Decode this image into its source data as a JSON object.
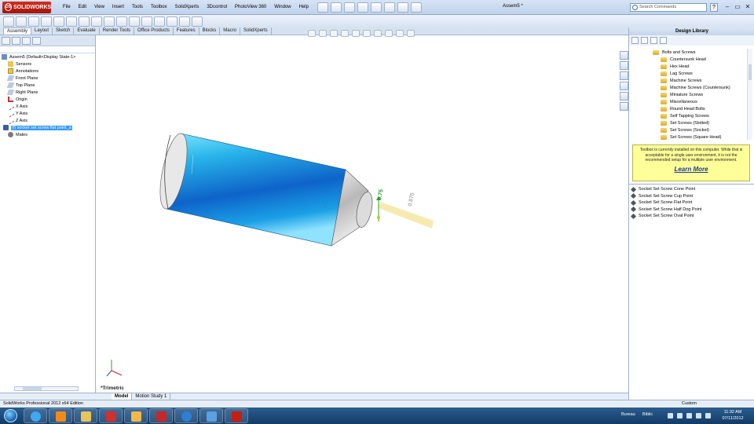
{
  "app": {
    "logo_text": "SOLIDWORKS",
    "logo_mark": "DS",
    "document_title": "Assem5 *",
    "brand_red": "#c41f14",
    "accent_blue": "#3399ff"
  },
  "menu": [
    "File",
    "Edit",
    "View",
    "Insert",
    "Tools",
    "Toolbox",
    "SolidXperts",
    "3Dcontrol",
    "PhotoView 360",
    "Window",
    "Help"
  ],
  "search": {
    "placeholder": "Search Commands",
    "icon": "search-icon"
  },
  "help_label": "?",
  "window_controls": {
    "minimize": "–",
    "restore": "▭",
    "close": "✕"
  },
  "command_tabs": [
    {
      "label": "Assembly",
      "active": true
    },
    {
      "label": "Layout"
    },
    {
      "label": "Sketch"
    },
    {
      "label": "Evaluate"
    },
    {
      "label": "Render Tools"
    },
    {
      "label": "Office Products"
    },
    {
      "label": "Features"
    },
    {
      "label": "Blocks"
    },
    {
      "label": "Macro"
    },
    {
      "label": "SolidXperts"
    }
  ],
  "feature_tree": {
    "root": "Assem5  (Default<Display State-1>",
    "items": [
      {
        "label": "Sensors",
        "icon": "sensors-icon"
      },
      {
        "label": "Annotations",
        "icon": "annotations-icon"
      },
      {
        "label": "Front Plane",
        "icon": "plane-icon"
      },
      {
        "label": "Top Plane",
        "icon": "plane-icon"
      },
      {
        "label": "Right Plane",
        "icon": "plane-icon"
      },
      {
        "label": "Origin",
        "icon": "origin-icon"
      },
      {
        "label": "X Axis",
        "icon": "axis-icon"
      },
      {
        "label": "Y Axis",
        "icon": "axis-icon"
      },
      {
        "label": "Z Axis",
        "icon": "axis-icon"
      },
      {
        "label": "(f) socket set screw flat point_a",
        "icon": "part-icon",
        "selected": true
      },
      {
        "label": "Mates",
        "icon": "mates-icon"
      }
    ]
  },
  "model_tabs": [
    {
      "label": "Model",
      "active": true
    },
    {
      "label": "Motion Study 1"
    }
  ],
  "graphics": {
    "view_label": "*Trimetric",
    "dimension_a": "0.75",
    "dimension_b": "0.875"
  },
  "design_library": {
    "title": "Design Library",
    "folder": "Bolts and Screws",
    "items": [
      "Countersunk Head",
      "Hex Head",
      "Lag Screws",
      "Machine Screws",
      "Machine Screws (Countersunk)",
      "Miniature Screws",
      "Miscellaneous",
      "Round Head Bolts",
      "Self Tapping Screws",
      "Set Screws (Slotted)",
      "Set Screws (Socket)",
      "Set Screws (Square Head)"
    ],
    "notice": "Toolbox is currently installed on this computer. While that is acceptable for a single user environment, it is not the recommended setup for a multiple user environment.",
    "learn_more": "Learn More",
    "parts": [
      "Socket Set Screw Cone Point",
      "Socket Set Screw Cup Point",
      "Socket Set Screw Flat Point",
      "Socket Set Screw Half Dog Point",
      "Socket Set Screw Oval Point"
    ]
  },
  "status": {
    "edition": "SolidWorks Professional 2012 x64 Edition",
    "custom": "Custom"
  },
  "taskbar": {
    "bureau": "Bureau",
    "biblio": "Biblic",
    "time": "11:32 AM",
    "date": "07/11/2012"
  }
}
